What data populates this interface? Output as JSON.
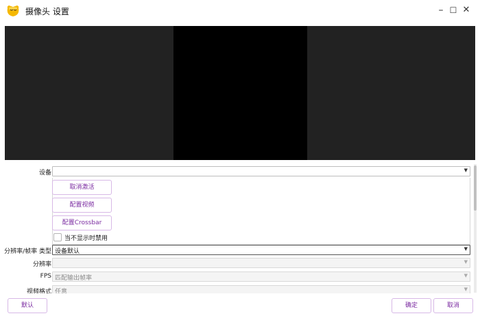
{
  "window": {
    "title": "摄像头 设置",
    "app_icon": "yellow-smiley-logo",
    "controls": {
      "minimize": "–",
      "maximize": "☐",
      "close": "✕"
    }
  },
  "settings": {
    "device": {
      "label": "设备",
      "value": ""
    },
    "buttons": {
      "deactivate": "取消激活",
      "configure_video": "配置视频",
      "configure_crossbar": "配置Crossbar"
    },
    "deactivate_when_hidden": {
      "label": "当不显示时禁用",
      "checked": false
    },
    "resolution_fps_type": {
      "label": "分辨率/帧率 类型",
      "value": "设备默认"
    },
    "resolution": {
      "label": "分辨率",
      "value": ""
    },
    "fps": {
      "label": "FPS",
      "value": "匹配输出帧率"
    },
    "video_format": {
      "label": "视频格式",
      "value": "任意"
    }
  },
  "footer": {
    "defaults": "默认",
    "ok": "确定",
    "cancel": "取消"
  },
  "colors": {
    "accent_text": "#7a2aa0",
    "accent_border": "#d7b8e6",
    "preview_bg": "#222222",
    "preview_center": "#000000"
  }
}
